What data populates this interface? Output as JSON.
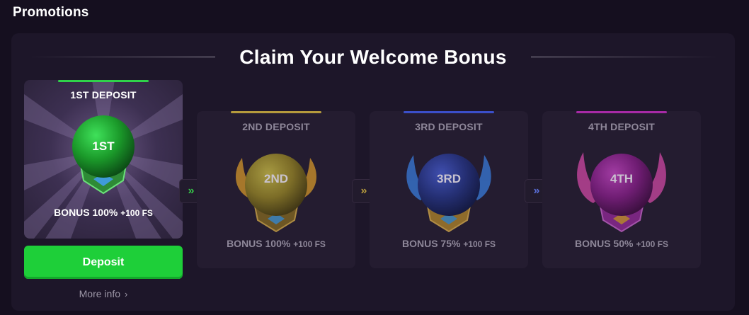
{
  "page": {
    "title": "Promotions"
  },
  "welcome": {
    "heading": "Claim Your Welcome Bonus",
    "cards": [
      {
        "title": "1ST DEPOSIT",
        "medal": "1ST",
        "bonus": "BONUS 100%",
        "fs": "+100 FS",
        "accent": "#2fd24a",
        "orb": "#1f9b2b",
        "active": true
      },
      {
        "title": "2ND DEPOSIT",
        "medal": "2ND",
        "bonus": "BONUS 100%",
        "fs": "+100 FS",
        "accent": "#b59a3c",
        "orb": "#9f8d25",
        "active": false
      },
      {
        "title": "3RD DEPOSIT",
        "medal": "3RD",
        "bonus": "BONUS 75%",
        "fs": "+100 FS",
        "accent": "#3b4fc9",
        "orb": "#26388f",
        "active": false
      },
      {
        "title": "4TH DEPOSIT",
        "medal": "4TH",
        "bonus": "BONUS 50%",
        "fs": "+100 FS",
        "accent": "#a72aa6",
        "orb": "#8e1f8f",
        "active": false
      }
    ],
    "arrows": [
      {
        "glyph": "»",
        "color": "#36c84a"
      },
      {
        "glyph": "»",
        "color": "#b59a3c"
      },
      {
        "glyph": "»",
        "color": "#5a6fd8"
      }
    ],
    "deposit_label": "Deposit",
    "more_info_label": "More info",
    "more_info_chevron": "›"
  },
  "colors": {
    "background": "#150f1f",
    "panel": "#1d1629",
    "cta_green": "#1ecf39"
  }
}
